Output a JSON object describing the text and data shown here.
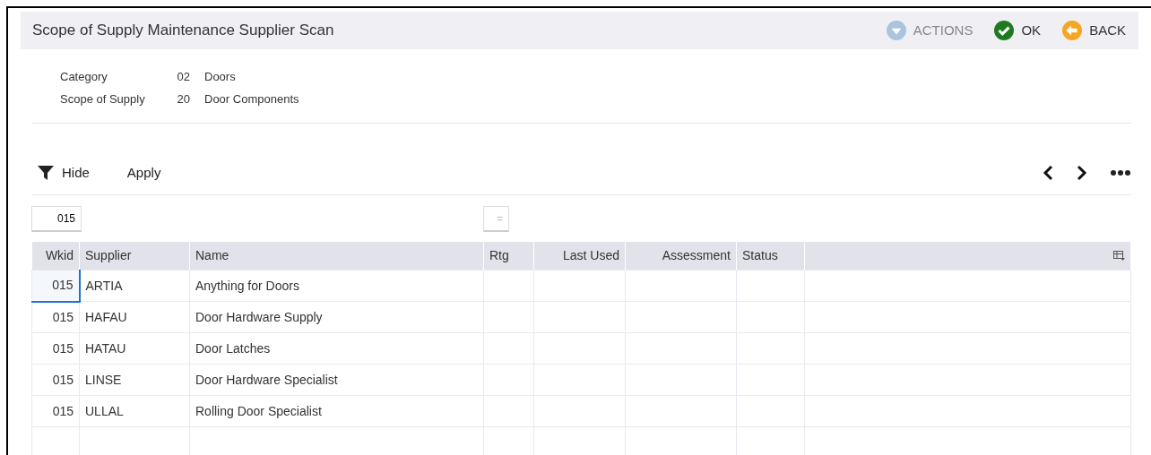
{
  "window": {
    "title": "Scope of Supply Maintenance Supplier Scan"
  },
  "header_actions": [
    {
      "kind": "actions",
      "label": "ACTIONS",
      "disabled": true
    },
    {
      "kind": "ok",
      "label": "OK",
      "disabled": false
    },
    {
      "kind": "back",
      "label": "BACK",
      "disabled": false
    }
  ],
  "info": [
    {
      "label": "Category",
      "code": "02",
      "description": "Doors"
    },
    {
      "label": "Scope of Supply",
      "code": "20",
      "description": "Door Components"
    }
  ],
  "toolbar": {
    "hide": "Hide",
    "apply": "Apply"
  },
  "filters": [
    {
      "value": "015"
    },
    {
      "placeholder": "="
    }
  ],
  "table": {
    "columns": [
      {
        "label": "Wkid"
      },
      {
        "label": "Supplier"
      },
      {
        "label": "Name"
      },
      {
        "label": "Rtg"
      },
      {
        "label": "Last Used"
      },
      {
        "label": "Assessment"
      },
      {
        "label": "Status"
      }
    ],
    "rows": [
      {
        "cells": [
          "015",
          "ARTIA",
          "Anything for Doors",
          "",
          "",
          "",
          ""
        ],
        "focused": true
      },
      {
        "cells": [
          "015",
          "HAFAU",
          "Door Hardware Supply",
          "",
          "",
          "",
          ""
        ],
        "focused": false
      },
      {
        "cells": [
          "015",
          "HATAU",
          "Door Latches",
          "",
          "",
          "",
          ""
        ],
        "focused": false
      },
      {
        "cells": [
          "015",
          "LINSE",
          "Door Hardware Specialist",
          "",
          "",
          "",
          ""
        ],
        "focused": false
      },
      {
        "cells": [
          "015",
          "ULLAL",
          "Rolling Door Specialist",
          "",
          "",
          "",
          ""
        ],
        "focused": false
      }
    ]
  }
}
